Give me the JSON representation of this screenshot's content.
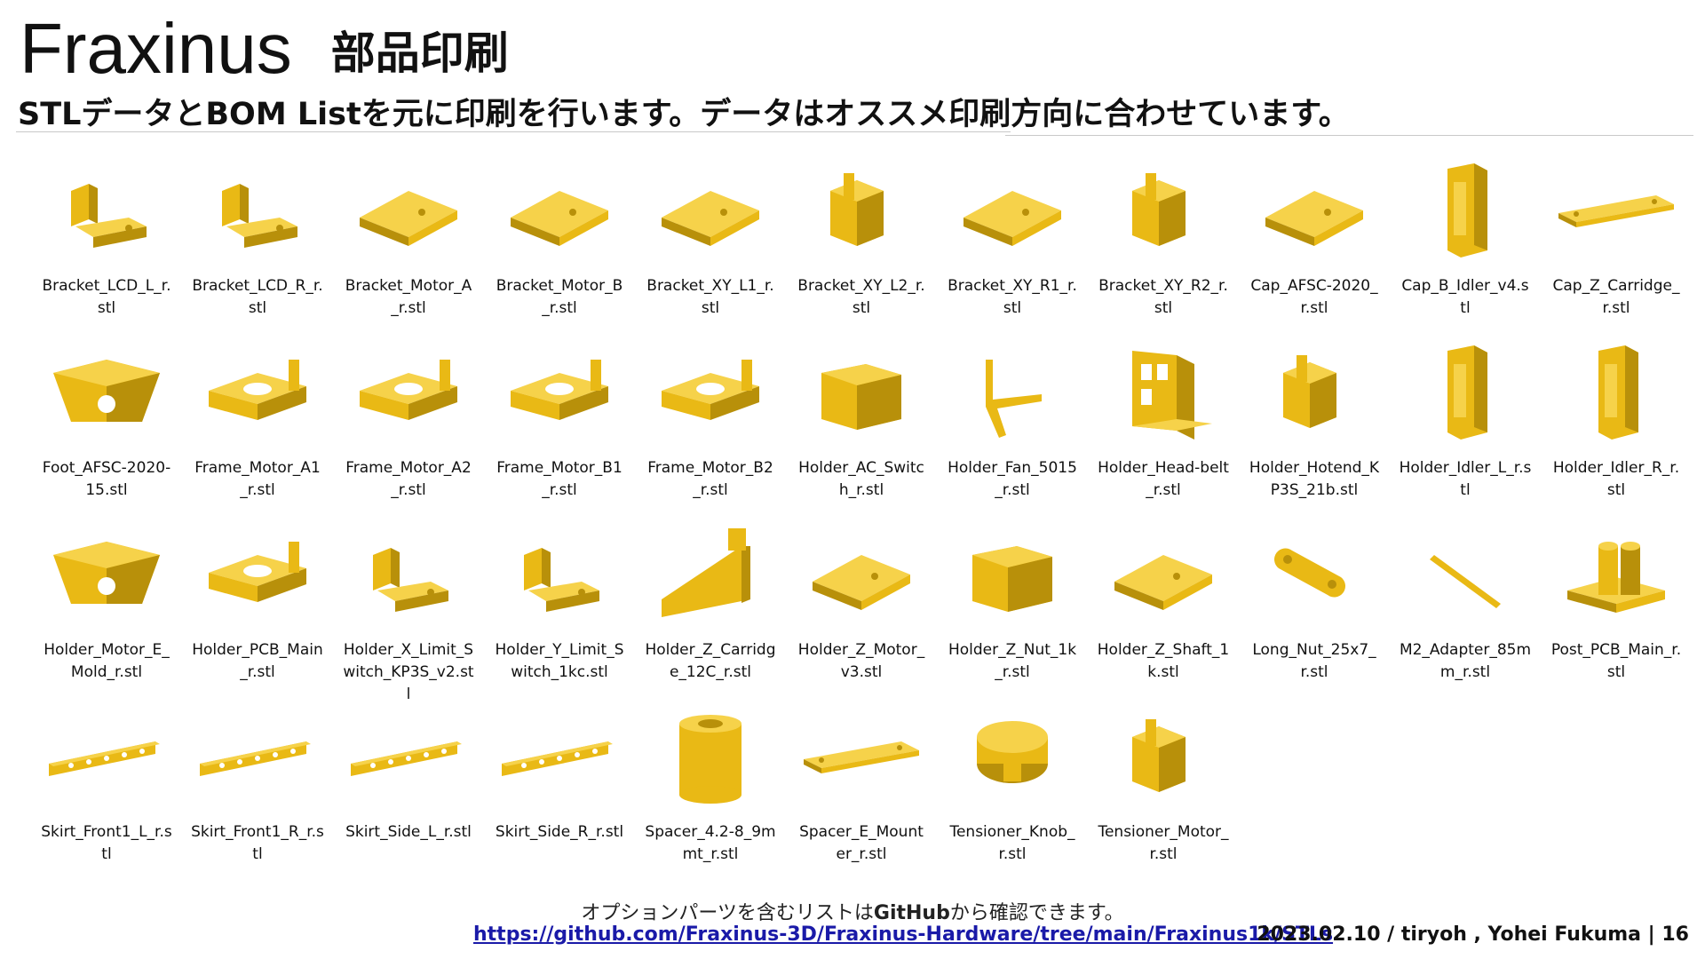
{
  "header": {
    "title": "Fraxinus",
    "title_jp": "部品印刷",
    "subtitle": "STLデータとBOM Listを元に印刷を行います。データはオススメ印刷方向に合わせています。"
  },
  "part_color": "#e9b915",
  "files": [
    {
      "name": "Bracket_LCD_L_r.stl",
      "icon": "bracket-part-icon"
    },
    {
      "name": "Bracket_LCD_R_r.stl",
      "icon": "bracket-part-icon"
    },
    {
      "name": "Bracket_Motor_A_r.stl",
      "icon": "plate-part-icon"
    },
    {
      "name": "Bracket_Motor_B_r.stl",
      "icon": "plate-part-icon"
    },
    {
      "name": "Bracket_XY_L1_r.stl",
      "icon": "plate-part-icon"
    },
    {
      "name": "Bracket_XY_L2_r.stl",
      "icon": "block-part-icon"
    },
    {
      "name": "Bracket_XY_R1_r.stl",
      "icon": "plate-part-icon"
    },
    {
      "name": "Bracket_XY_R2_r.stl",
      "icon": "block-part-icon"
    },
    {
      "name": "Cap_AFSC-2020_r.stl",
      "icon": "plate-part-icon"
    },
    {
      "name": "Cap_B_Idler_v4.stl",
      "icon": "tower-part-icon"
    },
    {
      "name": "Cap_Z_Carridge_r.stl",
      "icon": "flat-bar-part-icon"
    },
    {
      "name": "Foot_AFSC-2020-15.stl",
      "icon": "foot-part-icon"
    },
    {
      "name": "Frame_Motor_A1_r.stl",
      "icon": "frame-part-icon"
    },
    {
      "name": "Frame_Motor_A2_r.stl",
      "icon": "frame-part-icon"
    },
    {
      "name": "Frame_Motor_B1_r.stl",
      "icon": "frame-part-icon"
    },
    {
      "name": "Frame_Motor_B2_r.stl",
      "icon": "frame-part-icon"
    },
    {
      "name": "Holder_AC_Switch_r.stl",
      "icon": "box-part-icon"
    },
    {
      "name": "Holder_Fan_5015_r.stl",
      "icon": "hook-part-icon"
    },
    {
      "name": "Holder_Head-belt_r.stl",
      "icon": "panel-part-icon"
    },
    {
      "name": "Holder_Hotend_KP3S_21b.stl",
      "icon": "block-part-icon"
    },
    {
      "name": "Holder_Idler_L_r.stl",
      "icon": "tower-part-icon"
    },
    {
      "name": "Holder_Idler_R_r.stl",
      "icon": "tower-part-icon"
    },
    {
      "name": "Holder_Motor_E_Mold_r.stl",
      "icon": "foot-part-icon"
    },
    {
      "name": "Holder_PCB_Main_r.stl",
      "icon": "frame-part-icon"
    },
    {
      "name": "Holder_X_Limit_Switch_KP3S_v2.stl",
      "icon": "bracket-part-icon"
    },
    {
      "name": "Holder_Y_Limit_Switch_1kc.stl",
      "icon": "bracket-part-icon"
    },
    {
      "name": "Holder_Z_Carridge_12C_r.stl",
      "icon": "wedge-part-icon"
    },
    {
      "name": "Holder_Z_Motor_v3.stl",
      "icon": "plate-part-icon"
    },
    {
      "name": "Holder_Z_Nut_1k_r.stl",
      "icon": "box-part-icon"
    },
    {
      "name": "Holder_Z_Shaft_1k.stl",
      "icon": "plate-part-icon"
    },
    {
      "name": "Long_Nut_25x7_r.stl",
      "icon": "link-part-icon"
    },
    {
      "name": "M2_Adapter_85mm_r.stl",
      "icon": "rod-part-icon"
    },
    {
      "name": "Post_PCB_Main_r.stl",
      "icon": "post-part-icon"
    },
    {
      "name": "Skirt_Front1_L_r.stl",
      "icon": "skirt-part-icon"
    },
    {
      "name": "Skirt_Front1_R_r.stl",
      "icon": "skirt-part-icon"
    },
    {
      "name": "Skirt_Side_L_r.stl",
      "icon": "skirt-part-icon"
    },
    {
      "name": "Skirt_Side_R_r.stl",
      "icon": "skirt-part-icon"
    },
    {
      "name": "Spacer_4.2-8_9mmt_r.stl",
      "icon": "cylinder-part-icon"
    },
    {
      "name": "Spacer_E_Mounter_r.stl",
      "icon": "flat-bar-part-icon"
    },
    {
      "name": "Tensioner_Knob_r.stl",
      "icon": "knob-part-icon"
    },
    {
      "name": "Tensioner_Motor_r.stl",
      "icon": "block-part-icon"
    }
  ],
  "footer": {
    "note_before": "オプションパーツを含むリストは",
    "note_bold": "GitHub",
    "note_after": "から確認できます。",
    "link": "https://github.com/Fraxinus-3D/Fraxinus-Hardware/tree/main/Fraxinus1k/STLs",
    "credit": "2023.02.10 / tiryoh , Yohei Fukuma | 16"
  }
}
